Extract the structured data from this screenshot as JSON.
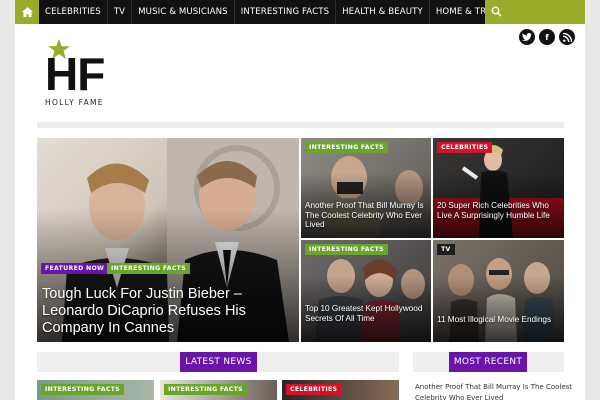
{
  "nav": {
    "items": [
      "CELEBRITIES",
      "TV",
      "MUSIC & MUSICIANS",
      "INTERESTING FACTS",
      "HEALTH & BEAUTY",
      "HOME & TRAVEL"
    ]
  },
  "social": {
    "twitter": "t",
    "facebook": "f",
    "rss": "r"
  },
  "logo": {
    "letters": "HF",
    "name": "HOLLY FAME"
  },
  "hero": {
    "main": {
      "badge1": "FEATURED NOW",
      "badge2": "INTERESTING FACTS",
      "title": "Tough Luck For Justin Bieber – Leonardo DiCaprio Refuses His Company In Cannes"
    },
    "tile1": {
      "badge": "INTERESTING FACTS",
      "title": "Another Proof That Bill Murray Is The Coolest Celebrity Who Ever Lived"
    },
    "tile2": {
      "badge": "CELEBRITIES",
      "title": "20 Super Rich Celebrities Who Live A Surprisingly Humble Life"
    },
    "tile3": {
      "badge": "INTERESTING FACTS",
      "title": "Top 10 Greatest Kept Hollywood Secrets Of All Time"
    },
    "tile4": {
      "badge": "TV",
      "title": "11 Most Illogical Movie Endings"
    }
  },
  "sections": {
    "latest": "LATEST NEWS",
    "recent": "MOST RECENT"
  },
  "bottom": {
    "badge1": "INTERESTING FACTS",
    "badge2": "INTERESTING FACTS",
    "badge3": "CELEBRITIES",
    "recent_item": "Another Proof That Bill Murray Is The Coolest Celebrity Who Ever Lived"
  },
  "colors": {
    "accent_green": "#9aaa2a",
    "badge_green": "#6aa52a",
    "purple": "#6a15a8",
    "red": "#d0142a"
  }
}
